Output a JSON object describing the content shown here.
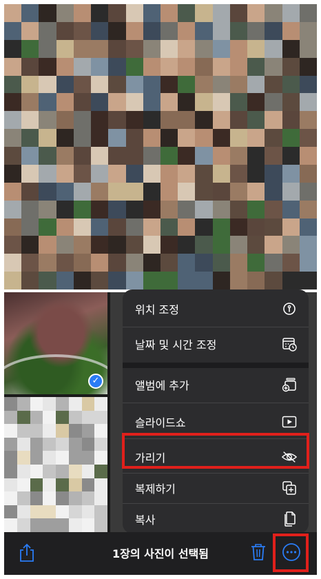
{
  "menu": {
    "items": [
      {
        "label": "위치 조정",
        "icon": "location-info-icon"
      },
      {
        "label": "날짜 및 시간 조정",
        "icon": "calendar-clock-icon"
      },
      {
        "label": "앨범에 추가",
        "icon": "add-to-album-icon"
      },
      {
        "label": "슬라이드쇼",
        "icon": "slideshow-play-icon"
      },
      {
        "label": "가리기",
        "icon": "eye-slash-icon"
      },
      {
        "label": "복제하기",
        "icon": "duplicate-icon"
      },
      {
        "label": "복사",
        "icon": "copy-icon"
      }
    ]
  },
  "toolbar": {
    "title": "1장의 사진이 선택됨",
    "share_icon": "share-icon",
    "trash_icon": "trash-icon",
    "more_icon": "more-ellipsis-icon"
  },
  "selection": {
    "check_icon": "checkmark-icon"
  },
  "colors": {
    "accent": "#2a7cf5",
    "highlight": "#e0201b",
    "menu_bg": "#2c2c2e"
  }
}
